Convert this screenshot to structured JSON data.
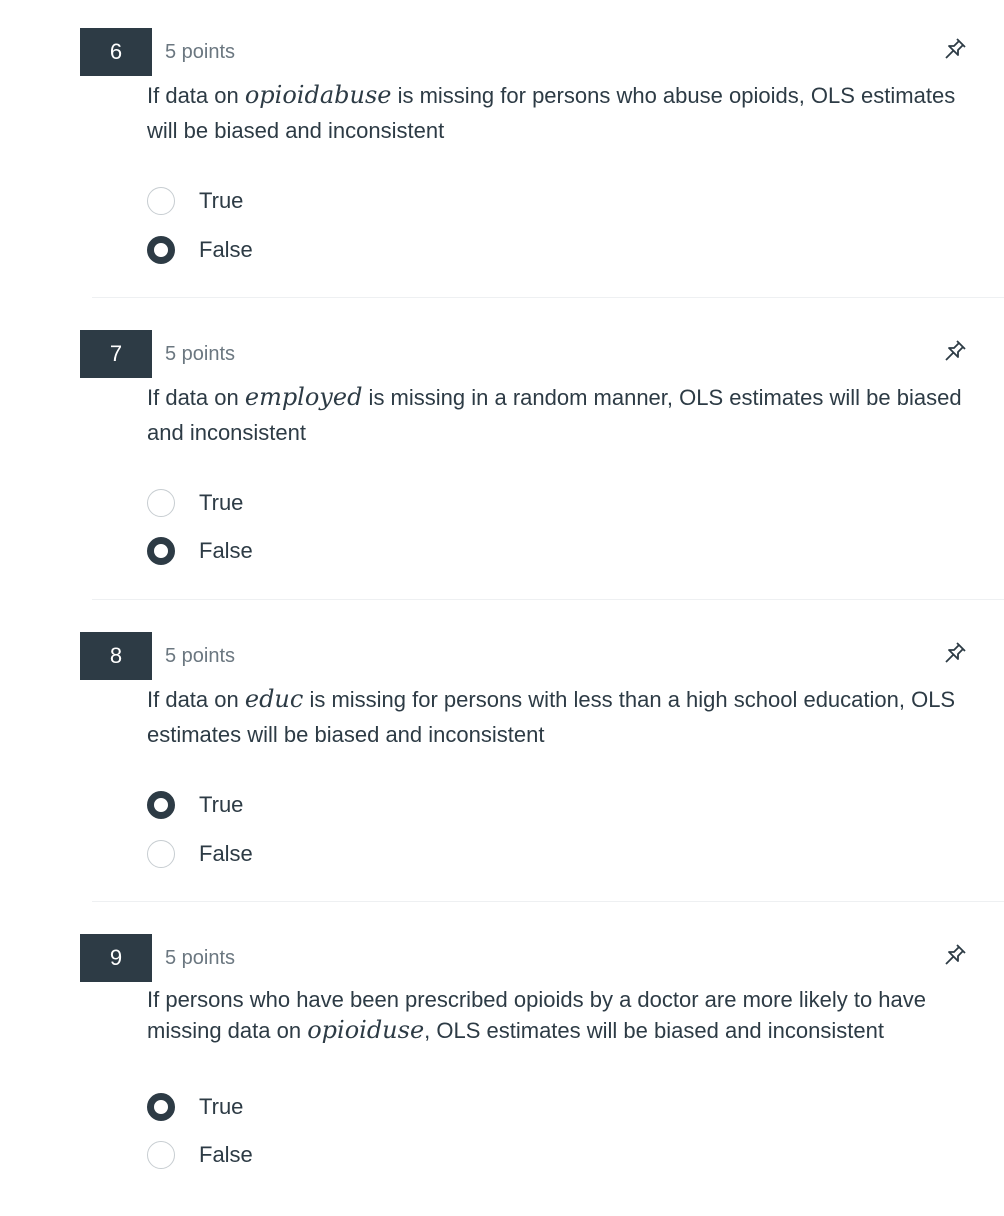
{
  "questions": [
    {
      "number": "6",
      "points": "5 points",
      "text_before": "If data on ",
      "math": "opioidabuse",
      "text_after": " is missing for persons who abuse opioids, OLS estimates will be biased and inconsistent",
      "answers": [
        {
          "label": "True",
          "selected": false
        },
        {
          "label": "False",
          "selected": true
        }
      ]
    },
    {
      "number": "7",
      "points": "5 points",
      "text_before": "If data on ",
      "math": "employed",
      "text_after": " is missing in a random manner, OLS estimates will be biased and inconsistent",
      "answers": [
        {
          "label": "True",
          "selected": false
        },
        {
          "label": "False",
          "selected": true
        }
      ]
    },
    {
      "number": "8",
      "points": "5 points",
      "text_before": "If data on ",
      "math": "educ",
      "text_after": " is missing for persons with less than a high school education, OLS estimates will be biased and inconsistent",
      "answers": [
        {
          "label": "True",
          "selected": true
        },
        {
          "label": "False",
          "selected": false
        }
      ]
    },
    {
      "number": "9",
      "points": "5 points",
      "text_before": "If persons who have been prescribed opioids by a doctor are more likely to have missing data on ",
      "math": "opioiduse",
      "text_after": ", OLS estimates will be biased and inconsistent",
      "answers": [
        {
          "label": "True",
          "selected": true
        },
        {
          "label": "False",
          "selected": false
        }
      ]
    }
  ],
  "icons": {
    "pin": "pin-icon"
  },
  "colors": {
    "badge_bg": "#2d3b45",
    "text": "#2d3b45",
    "points": "#6b7780",
    "radio_border": "#c7cdd1"
  }
}
